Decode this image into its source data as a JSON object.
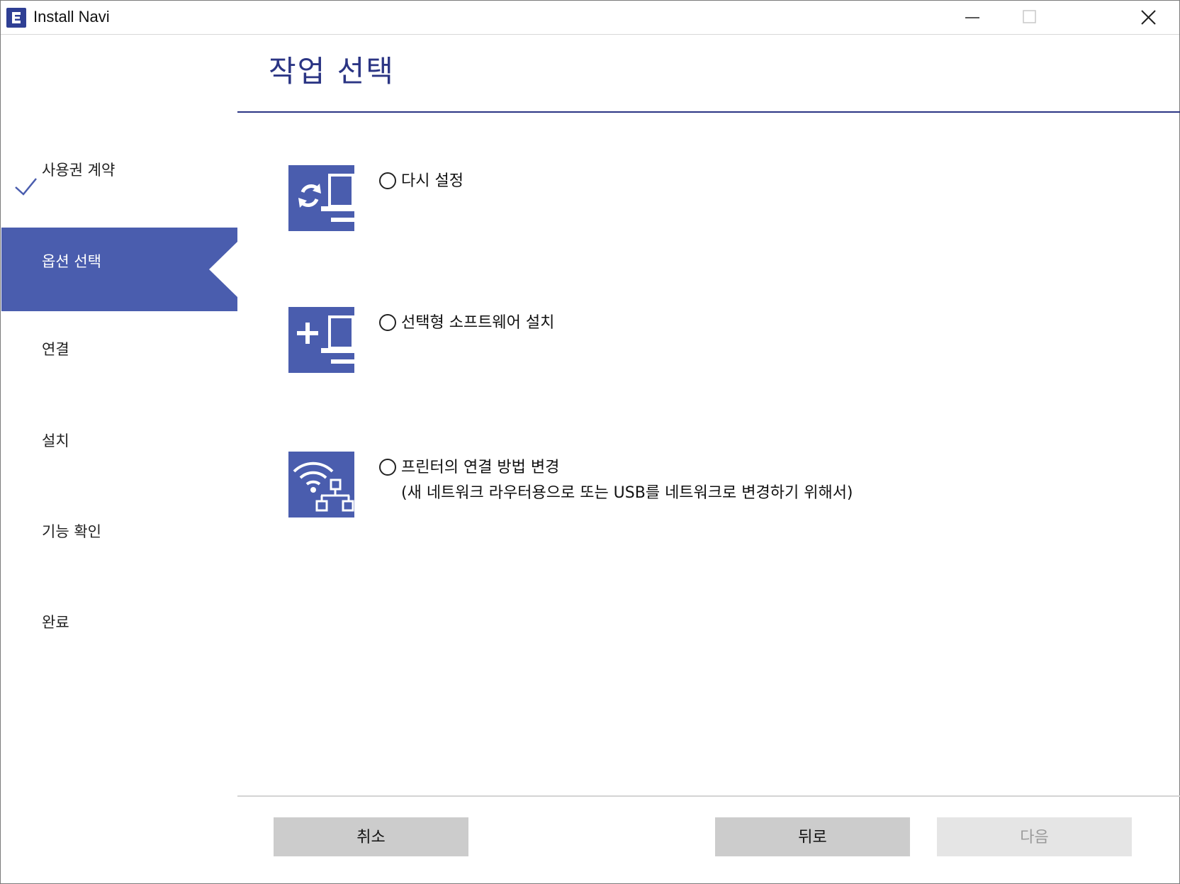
{
  "window": {
    "title": "Install Navi"
  },
  "sidebar": {
    "steps": [
      {
        "label": "사용권 계약",
        "state": "done"
      },
      {
        "label": "옵션 선택",
        "state": "active"
      },
      {
        "label": "연결",
        "state": "pending"
      },
      {
        "label": "설치",
        "state": "pending"
      },
      {
        "label": "기능 확인",
        "state": "pending"
      },
      {
        "label": "완료",
        "state": "pending"
      }
    ]
  },
  "main": {
    "heading": "작업 선택",
    "options": [
      {
        "label": "다시 설정",
        "icon": "reinstall-computer-icon",
        "selected": false
      },
      {
        "label": "선택형 소프트웨어 설치",
        "icon": "add-software-computer-icon",
        "selected": false
      },
      {
        "label": "프린터의 연결 방법 변경",
        "sub": "(새 네트워크 라우터용으로 또는 USB를 네트워크로 변경하기 위해서)",
        "icon": "wifi-network-icon",
        "selected": false
      }
    ]
  },
  "footer": {
    "cancel_label": "취소",
    "back_label": "뒤로",
    "next_label": "다음",
    "next_enabled": false
  },
  "colors": {
    "accent": "#4a5dae",
    "heading": "#2b3584"
  }
}
